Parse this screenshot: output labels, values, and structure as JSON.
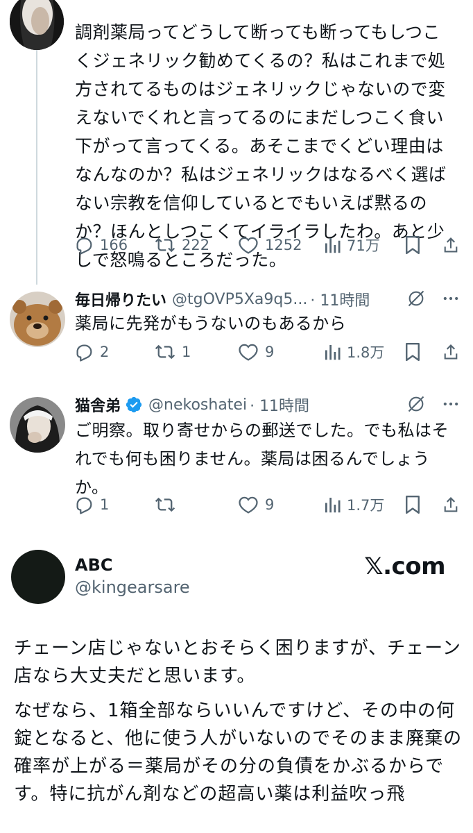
{
  "tweet_main": {
    "text": "調剤薬局ってどうして断っても断ってもしつこくジェネリック勧めてくるの？私はこれまで処方されてるものはジェネリックじゃないので変えないでくれと言ってるのにまだしつこく食い下がって言ってくる。あそこまでくどい理由はなんなのか？私はジェネリックはなるべく選ばない宗教を信仰しているとでもいえば黙るのか？ほんとしつこくてイライラしたわ。あと少しで怒鳴るところだった。",
    "replies": "166",
    "retweets": "222",
    "likes": "1252",
    "views": "71万"
  },
  "reply1": {
    "name": "毎日帰りたい",
    "handle": "@tgOVP5Xa9q5...",
    "time": "· 11時間",
    "text": "薬局に先発がもうないのもあるから",
    "replies": "2",
    "retweets": "1",
    "likes": "9",
    "views": "1.8万"
  },
  "reply2": {
    "name": "猫舎弟",
    "handle": "@nekoshatei",
    "time": "· 11時間",
    "text": "ご明察。取り寄せからの郵送でした。でも私はそれでも何も困りません。薬局は困るんでしょうか。",
    "replies": "1",
    "retweets": "",
    "likes": "9",
    "views": "1.7万"
  },
  "card": {
    "name": "ABC",
    "handle": "@kingearsare",
    "brand": "𝕏.com",
    "text_p1": "チェーン店じゃないとおそらく困りますが、チェーン店なら大丈夫だと思います。",
    "text_p2": "なぜなら、1箱全部ならいいんですけど、その中の何錠となると、他に使う人がいないのでそのまま廃棄の確率が上がる＝薬局がその分の負債をかぶるからです。特に抗がん剤などの超高い薬は利益吹っ飛"
  },
  "colors": {
    "text": "#0f1419",
    "secondary": "#536471",
    "line": "#cfd9de",
    "verified": "#1d9bf0"
  }
}
